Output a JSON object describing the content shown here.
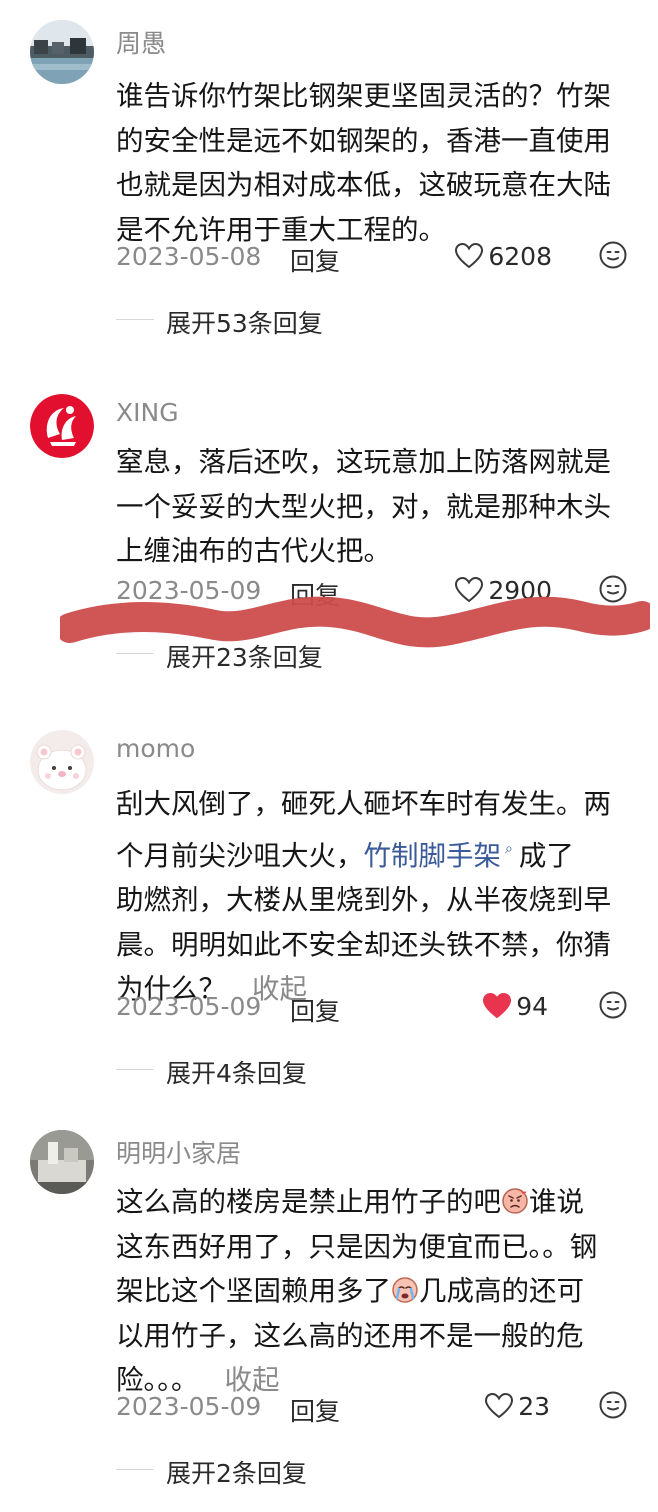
{
  "comments": [
    {
      "username": "周愚",
      "lines": [
        "谁告诉你竹架比钢架更坚固灵活的？竹架",
        "的安全性是远不如钢架的，香港一直使用",
        "也就是因为相对成本低，这破玩意在大陆",
        "是不允许用于重大工程的。"
      ],
      "date": "2023-05-08",
      "reply_label": "回复",
      "likes": "6208",
      "liked": false,
      "expand_label": "展开53条回复"
    },
    {
      "username": "XING",
      "lines": [
        "窒息，落后还吹，这玩意加上防落网就是",
        "一个妥妥的大型火把，对，就是那种木头",
        "上缠油布的古代火把。"
      ],
      "date": "2023-05-09",
      "reply_label": "回复",
      "likes": "2900",
      "liked": false,
      "expand_label": "展开23条回复"
    },
    {
      "username": "momo",
      "line1": "刮大风倒了，砸死人砸坏车时有发生。两",
      "line2_pre": "个月前尖沙咀大火，",
      "link": "竹制脚手架",
      "line2_post": "成了",
      "line3": "助燃剂，大楼从里烧到外，从半夜烧到早",
      "line4": "晨。明明如此不安全却还头铁不禁，你猜",
      "line5": "为什么？",
      "collapse_label": "收起",
      "date": "2023-05-09",
      "reply_label": "回复",
      "likes": "94",
      "liked": true,
      "expand_label": "展开4条回复"
    },
    {
      "username": "明明小家居",
      "line1": "这么高的楼房是禁止用竹子的吧",
      "line1_post": "谁说",
      "line2": "这东西好用了，只是因为便宜而已。。钢",
      "line3_pre": "架比这个坚固赖用多了",
      "line3_post": "几成高的还可",
      "line4": "以用竹子，这么高的还用不是一般的危",
      "line5": "险。。。",
      "collapse_label": "收起",
      "date": "2023-05-09",
      "reply_label": "回复",
      "likes": "23",
      "liked": false,
      "expand_label": "展开2条回复"
    }
  ],
  "icons": {
    "heart": "heart-icon",
    "heart_filled": "heart-filled-icon",
    "emoji": "smiley-icon",
    "link": "search-icon"
  },
  "colors": {
    "like_active": "#e8344e",
    "link": "#3a5a99",
    "scribble": "#cd4c4c"
  }
}
